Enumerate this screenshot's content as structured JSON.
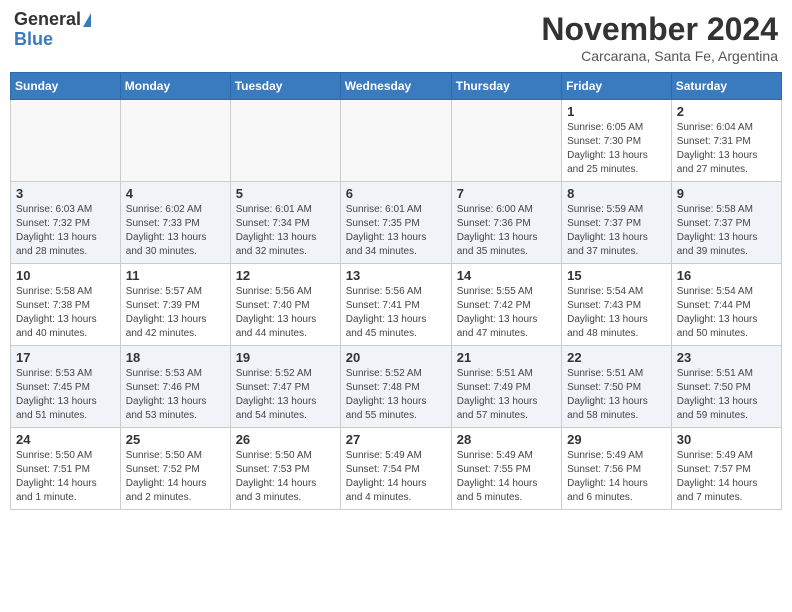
{
  "header": {
    "logo_general": "General",
    "logo_blue": "Blue",
    "month_title": "November 2024",
    "location": "Carcarana, Santa Fe, Argentina"
  },
  "days_of_week": [
    "Sunday",
    "Monday",
    "Tuesday",
    "Wednesday",
    "Thursday",
    "Friday",
    "Saturday"
  ],
  "weeks": [
    [
      {
        "day": "",
        "info": ""
      },
      {
        "day": "",
        "info": ""
      },
      {
        "day": "",
        "info": ""
      },
      {
        "day": "",
        "info": ""
      },
      {
        "day": "",
        "info": ""
      },
      {
        "day": "1",
        "info": "Sunrise: 6:05 AM\nSunset: 7:30 PM\nDaylight: 13 hours\nand 25 minutes."
      },
      {
        "day": "2",
        "info": "Sunrise: 6:04 AM\nSunset: 7:31 PM\nDaylight: 13 hours\nand 27 minutes."
      }
    ],
    [
      {
        "day": "3",
        "info": "Sunrise: 6:03 AM\nSunset: 7:32 PM\nDaylight: 13 hours\nand 28 minutes."
      },
      {
        "day": "4",
        "info": "Sunrise: 6:02 AM\nSunset: 7:33 PM\nDaylight: 13 hours\nand 30 minutes."
      },
      {
        "day": "5",
        "info": "Sunrise: 6:01 AM\nSunset: 7:34 PM\nDaylight: 13 hours\nand 32 minutes."
      },
      {
        "day": "6",
        "info": "Sunrise: 6:01 AM\nSunset: 7:35 PM\nDaylight: 13 hours\nand 34 minutes."
      },
      {
        "day": "7",
        "info": "Sunrise: 6:00 AM\nSunset: 7:36 PM\nDaylight: 13 hours\nand 35 minutes."
      },
      {
        "day": "8",
        "info": "Sunrise: 5:59 AM\nSunset: 7:37 PM\nDaylight: 13 hours\nand 37 minutes."
      },
      {
        "day": "9",
        "info": "Sunrise: 5:58 AM\nSunset: 7:37 PM\nDaylight: 13 hours\nand 39 minutes."
      }
    ],
    [
      {
        "day": "10",
        "info": "Sunrise: 5:58 AM\nSunset: 7:38 PM\nDaylight: 13 hours\nand 40 minutes."
      },
      {
        "day": "11",
        "info": "Sunrise: 5:57 AM\nSunset: 7:39 PM\nDaylight: 13 hours\nand 42 minutes."
      },
      {
        "day": "12",
        "info": "Sunrise: 5:56 AM\nSunset: 7:40 PM\nDaylight: 13 hours\nand 44 minutes."
      },
      {
        "day": "13",
        "info": "Sunrise: 5:56 AM\nSunset: 7:41 PM\nDaylight: 13 hours\nand 45 minutes."
      },
      {
        "day": "14",
        "info": "Sunrise: 5:55 AM\nSunset: 7:42 PM\nDaylight: 13 hours\nand 47 minutes."
      },
      {
        "day": "15",
        "info": "Sunrise: 5:54 AM\nSunset: 7:43 PM\nDaylight: 13 hours\nand 48 minutes."
      },
      {
        "day": "16",
        "info": "Sunrise: 5:54 AM\nSunset: 7:44 PM\nDaylight: 13 hours\nand 50 minutes."
      }
    ],
    [
      {
        "day": "17",
        "info": "Sunrise: 5:53 AM\nSunset: 7:45 PM\nDaylight: 13 hours\nand 51 minutes."
      },
      {
        "day": "18",
        "info": "Sunrise: 5:53 AM\nSunset: 7:46 PM\nDaylight: 13 hours\nand 53 minutes."
      },
      {
        "day": "19",
        "info": "Sunrise: 5:52 AM\nSunset: 7:47 PM\nDaylight: 13 hours\nand 54 minutes."
      },
      {
        "day": "20",
        "info": "Sunrise: 5:52 AM\nSunset: 7:48 PM\nDaylight: 13 hours\nand 55 minutes."
      },
      {
        "day": "21",
        "info": "Sunrise: 5:51 AM\nSunset: 7:49 PM\nDaylight: 13 hours\nand 57 minutes."
      },
      {
        "day": "22",
        "info": "Sunrise: 5:51 AM\nSunset: 7:50 PM\nDaylight: 13 hours\nand 58 minutes."
      },
      {
        "day": "23",
        "info": "Sunrise: 5:51 AM\nSunset: 7:50 PM\nDaylight: 13 hours\nand 59 minutes."
      }
    ],
    [
      {
        "day": "24",
        "info": "Sunrise: 5:50 AM\nSunset: 7:51 PM\nDaylight: 14 hours\nand 1 minute."
      },
      {
        "day": "25",
        "info": "Sunrise: 5:50 AM\nSunset: 7:52 PM\nDaylight: 14 hours\nand 2 minutes."
      },
      {
        "day": "26",
        "info": "Sunrise: 5:50 AM\nSunset: 7:53 PM\nDaylight: 14 hours\nand 3 minutes."
      },
      {
        "day": "27",
        "info": "Sunrise: 5:49 AM\nSunset: 7:54 PM\nDaylight: 14 hours\nand 4 minutes."
      },
      {
        "day": "28",
        "info": "Sunrise: 5:49 AM\nSunset: 7:55 PM\nDaylight: 14 hours\nand 5 minutes."
      },
      {
        "day": "29",
        "info": "Sunrise: 5:49 AM\nSunset: 7:56 PM\nDaylight: 14 hours\nand 6 minutes."
      },
      {
        "day": "30",
        "info": "Sunrise: 5:49 AM\nSunset: 7:57 PM\nDaylight: 14 hours\nand 7 minutes."
      }
    ]
  ]
}
